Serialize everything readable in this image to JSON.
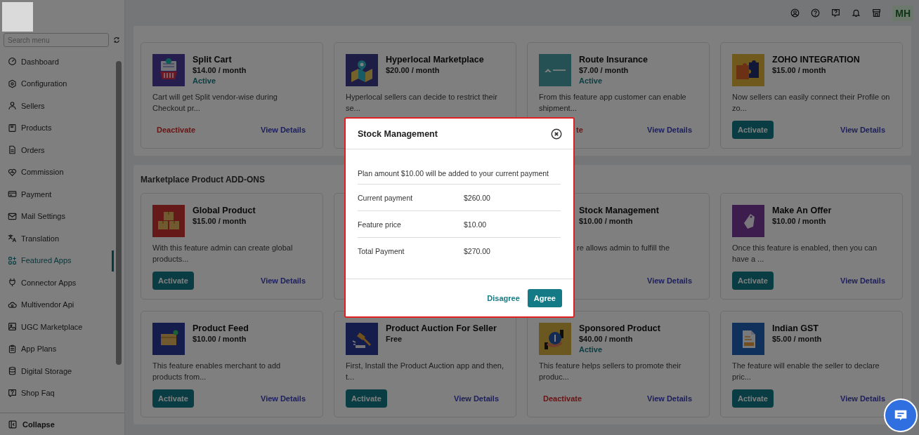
{
  "sidebar": {
    "search": {
      "placeholder": "Search menu"
    },
    "items": [
      {
        "label": "Dashboard",
        "selected": false
      },
      {
        "label": "Configuration",
        "selected": false
      },
      {
        "label": "Sellers",
        "selected": false
      },
      {
        "label": "Products",
        "selected": false
      },
      {
        "label": "Orders",
        "selected": false
      },
      {
        "label": "Commission",
        "selected": false
      },
      {
        "label": "Payment",
        "selected": false
      },
      {
        "label": "Mail Settings",
        "selected": false
      },
      {
        "label": "Translation",
        "selected": false
      },
      {
        "label": "Featured Apps",
        "selected": true
      },
      {
        "label": "Connector Apps",
        "selected": false
      },
      {
        "label": "Multivendor Api",
        "selected": false
      },
      {
        "label": "UGC Marketplace",
        "selected": false
      },
      {
        "label": "App Plans",
        "selected": false
      },
      {
        "label": "Digital Storage",
        "selected": false
      },
      {
        "label": "Shop Faq",
        "selected": false
      }
    ],
    "collapse": "Collapse"
  },
  "header": {
    "avatar": "MH"
  },
  "sections": [
    {
      "cards": [
        {
          "kind": "app",
          "name": "Split Cart",
          "price": "$14.00 / month",
          "status": "Active",
          "description": "Cart will get Split vendor-wise during Checkout pr...",
          "action": {
            "kind": "deactivate",
            "label": "Deactivate",
            "partial": false
          },
          "details": "View Details"
        },
        {
          "kind": "app",
          "name": "Hyperlocal Marketplace",
          "price": "$20.00 / month",
          "description": "Hyperlocal sellers can decide to restrict their se..."
        },
        {
          "kind": "app",
          "name": "Route Insurance",
          "price": "$7.00 / month",
          "status": "Active",
          "description": "From this feature app customer can enable shipment...",
          "action": {
            "kind": "deactivate",
            "label": "te",
            "partial": true
          },
          "details": "View Details"
        },
        {
          "kind": "app",
          "name": "ZOHO INTEGRATION",
          "price": "$15.00 / month",
          "description": "Now sellers can easily connect their Profile on zo...",
          "action": {
            "kind": "activate",
            "label": "Activate",
            "partial": false
          },
          "details": "View Details"
        }
      ]
    },
    {
      "title": "Marketplace Product ADD-ONS",
      "cards": [
        {
          "kind": "app",
          "name": "Global Product",
          "price": "$15.00 / month",
          "description": "With this feature admin can create global products...",
          "action": {
            "kind": "activate",
            "label": "Activate",
            "partial": false
          },
          "details": "View Details"
        },
        {
          "kind": "covered"
        },
        {
          "kind": "app",
          "name": "Stock Management",
          "price": "$10.00 / month",
          "description": "re allows admin to fulfill the",
          "description_partial": true,
          "details": "View Details"
        },
        {
          "kind": "app",
          "name": "Make An Offer",
          "price": "$10.00 / month",
          "description": "Once this feature is enabled, then you can have a ...",
          "action": {
            "kind": "activate",
            "label": "Activate",
            "partial": false
          },
          "details": "View Details"
        },
        {
          "kind": "app",
          "name": "Product Feed",
          "price": "$10.00 / month",
          "description": "This feature enables merchant to add products from...",
          "action": {
            "kind": "activate",
            "label": "Activate",
            "partial": false
          },
          "details": "View Details"
        },
        {
          "kind": "app",
          "name": "Product Auction For Seller",
          "price": "Free",
          "description": "First, Install the Product Auction app and then, t...",
          "action": {
            "kind": "activate",
            "label": "Activate",
            "partial": false
          },
          "details": "View Details"
        },
        {
          "kind": "app",
          "name": "Sponsored Product",
          "price": "$40.00 / month",
          "status": "Active",
          "description": "This feature helps sellers to promote their produc...",
          "action": {
            "kind": "deactivate",
            "label": "Deactivate",
            "partial": false
          },
          "details": "View Details"
        },
        {
          "kind": "app",
          "name": "Indian GST",
          "price": "$5.00 / month",
          "description": "The feature will enable the seller to declare pric...",
          "action": {
            "kind": "activate",
            "label": "Activate",
            "partial": false
          },
          "details": "View Details"
        }
      ]
    }
  ],
  "modal": {
    "title": "Stock Management",
    "notice": "Plan amount $10.00 will be added to your current payment",
    "rows": [
      {
        "label": "Current payment",
        "value": "$260.00"
      },
      {
        "label": "Feature price",
        "value": "$10.00"
      },
      {
        "label": "Total Payment",
        "value": "$270.00"
      }
    ],
    "buttons": [
      {
        "kind": "link",
        "label": "Disagree"
      },
      {
        "kind": "primary",
        "label": "Agree"
      }
    ]
  }
}
